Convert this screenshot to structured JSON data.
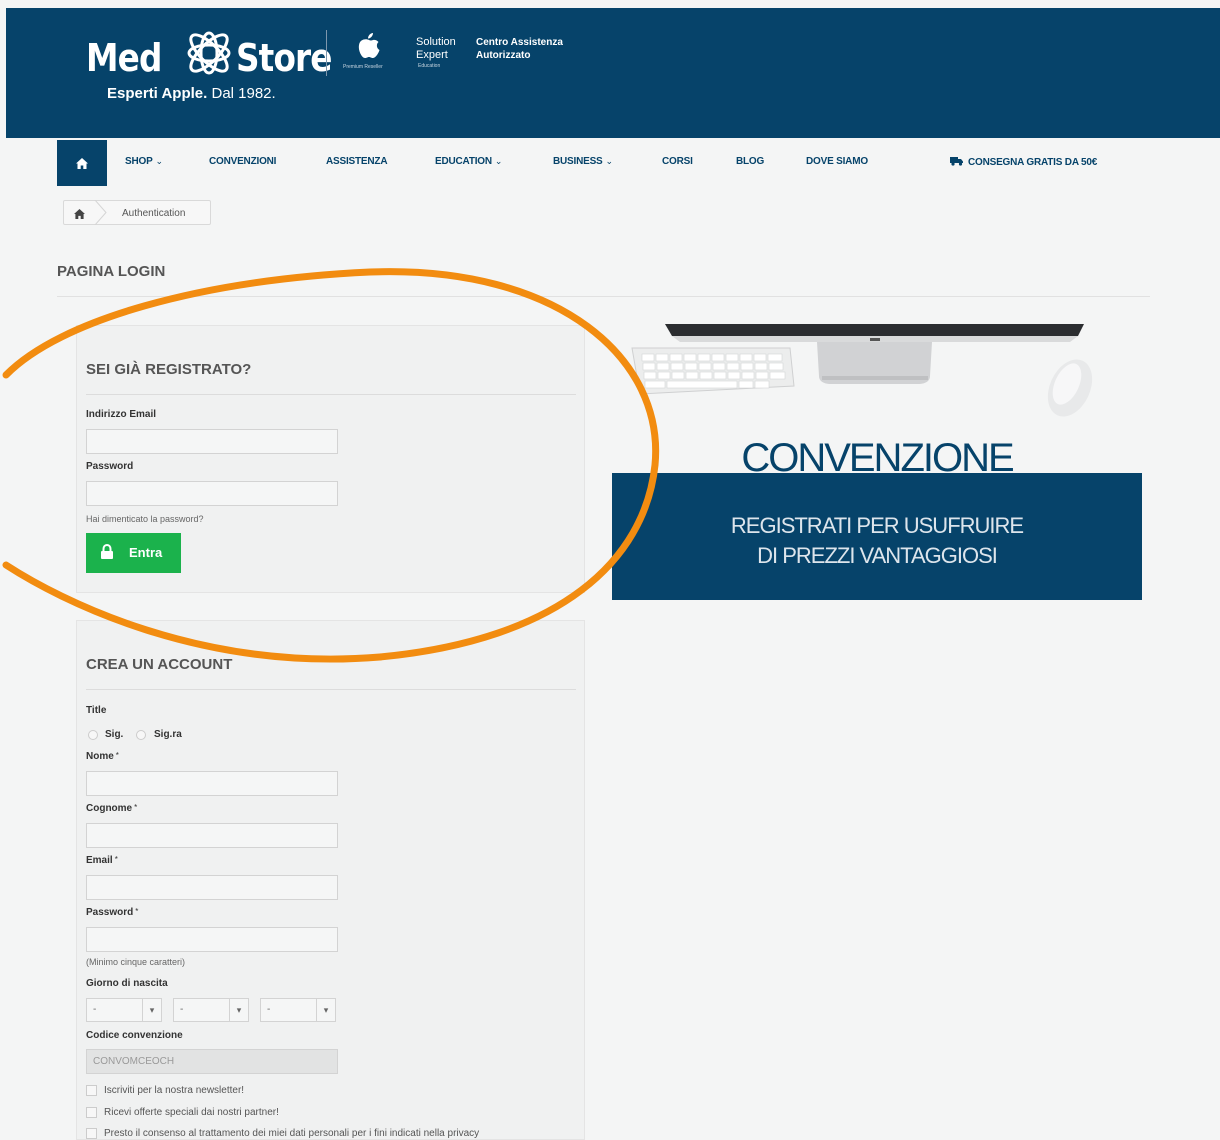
{
  "header": {
    "logo_left": "Med",
    "logo_right": "Store",
    "tagline_bold": "Esperti Apple.",
    "tagline_light": "Dal 1982.",
    "apple_small": "Premium Reseller",
    "solution_line1": "Solution",
    "solution_line2": "Expert",
    "solution_small": "Education",
    "centro_line1": "Centro Assistenza",
    "centro_line2": "Autorizzato"
  },
  "nav": {
    "shop": "SHOP",
    "convenzioni": "CONVENZIONI",
    "assistenza": "ASSISTENZA",
    "education": "EDUCATION",
    "business": "BUSINESS",
    "corsi": "CORSI",
    "blog": "BLOG",
    "dove_siamo": "DOVE SIAMO",
    "consegna": "CONSEGNA GRATIS DA 50€",
    "chevron": "⌄"
  },
  "breadcrumb": {
    "current": "Authentication"
  },
  "page": {
    "title": "PAGINA LOGIN"
  },
  "login": {
    "title": "SEI GIÀ REGISTRATO?",
    "email_label": "Indirizzo Email",
    "email_value": "",
    "password_label": "Password",
    "password_value": "",
    "forgot": "Hai dimenticato la password?",
    "submit": "Entra"
  },
  "create": {
    "title": "CREA UN ACCOUNT",
    "title_label": "Title",
    "mr": "Sig.",
    "mrs": "Sig.ra",
    "nome": "Nome",
    "cognome": "Cognome",
    "email": "Email",
    "password": "Password",
    "required_mark": "*",
    "password_hint": "(Minimo cinque caratteri)",
    "birth_label": "Giorno di nascita",
    "birth_day": "-",
    "birth_month": "-",
    "birth_year": "-",
    "select_arrow": "▾",
    "code_label": "Codice convenzione",
    "code_value": "CONVOMCEOCH",
    "newsletter": "Iscriviti per la nostra newsletter!",
    "offers": "Ricevi offerte speciali dai nostri partner!",
    "privacy": "Presto il consenso al trattamento dei miei dati personali per i fini indicati nella privacy"
  },
  "promo": {
    "title": "CONVENZIONE",
    "line1": "REGISTRATI PER USUFRUIRE",
    "line2": "DI PREZZI VANTAGGIOSI"
  },
  "colors": {
    "brand_blue": "#06436a",
    "button_green": "#1bb24c",
    "annotation_orange": "#f28c10"
  }
}
